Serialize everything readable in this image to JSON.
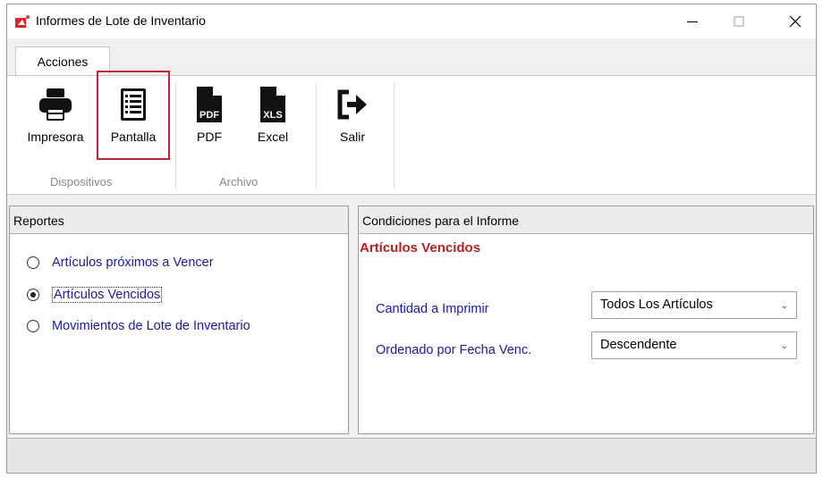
{
  "window": {
    "title": "Informes de Lote de Inventario",
    "controls": {
      "minimize": "—",
      "maximize": "☐",
      "close": "✕"
    }
  },
  "ribbon": {
    "tab": "Acciones",
    "buttons": {
      "impresora": "Impresora",
      "pantalla": "Pantalla",
      "pdf": "PDF",
      "excel": "Excel",
      "salir": "Salir"
    },
    "groups": {
      "dispositivos": "Dispositivos",
      "archivo": "Archivo"
    },
    "selected_button": "pantalla",
    "icons": {
      "impresora": "printer-icon",
      "pantalla": "screen-report-icon",
      "pdf": "pdf-file-icon",
      "excel": "xls-file-icon",
      "salir": "exit-icon"
    },
    "icon_badges": {
      "pdf": "PDF",
      "xls": "XLS"
    }
  },
  "reportes": {
    "header": "Reportes",
    "options": [
      {
        "label": "Artículos próximos a Vencer",
        "checked": false
      },
      {
        "label": "Artículos Vencidos",
        "checked": true
      },
      {
        "label": "Movimientos de Lote de Inventario",
        "checked": false
      }
    ]
  },
  "condiciones": {
    "header": "Condiciones para el Informe",
    "title": "Artículos Vencidos",
    "fields": [
      {
        "label": "Cantidad a Imprimir",
        "value": "Todos Los Artículos"
      },
      {
        "label": "Ordenado por Fecha Venc.",
        "value": "Descendente"
      }
    ]
  },
  "colors": {
    "link_blue": "#1a1aa6",
    "title_red": "#b0241f",
    "selection_red": "#c0272d"
  }
}
